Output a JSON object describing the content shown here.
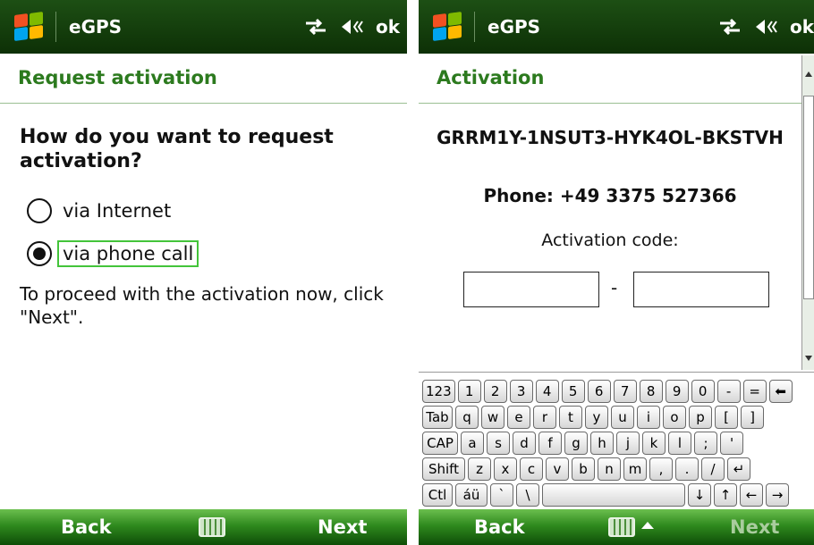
{
  "left_screen": {
    "title": "eGPS",
    "status_ok": "ok",
    "page_heading": "Request activation",
    "question": "How do you want to request activation?",
    "options": [
      {
        "label": "via Internet",
        "selected": false
      },
      {
        "label": "via phone call",
        "selected": true
      }
    ],
    "note": "To proceed with the activation now, click \"Next\".",
    "softkeys": {
      "left": "Back",
      "right": "Next"
    }
  },
  "right_screen": {
    "title": "eGPS",
    "status_ok": "ok",
    "page_heading": "Activation",
    "installation_code": "GRRM1Y-1NSUT3-HYK4OL-BKSTVH",
    "phone_line": "Phone: +49 3375 527366",
    "activation_code_label": "Activation code:",
    "activation_code_part1": "",
    "activation_code_part2": "",
    "separator": "-",
    "softkeys": {
      "left": "Back",
      "right": "Next"
    },
    "keyboard_rows": [
      [
        "123",
        "1",
        "2",
        "3",
        "4",
        "5",
        "6",
        "7",
        "8",
        "9",
        "0",
        "-",
        "=",
        "⬅"
      ],
      [
        "Tab",
        "q",
        "w",
        "e",
        "r",
        "t",
        "y",
        "u",
        "i",
        "o",
        "p",
        "[",
        "]"
      ],
      [
        "CAP",
        "a",
        "s",
        "d",
        "f",
        "g",
        "h",
        "j",
        "k",
        "l",
        ";",
        "'"
      ],
      [
        "Shift",
        "z",
        "x",
        "c",
        "v",
        "b",
        "n",
        "m",
        ",",
        ".",
        "/",
        "↵"
      ],
      [
        "Ctl",
        "áü",
        "`",
        "\\",
        " ",
        "↓",
        "↑",
        "←",
        "→"
      ]
    ]
  },
  "icons": [
    "windows-logo-icon",
    "connectivity-icon",
    "volume-mute-icon",
    "keyboard-icon",
    "caret-up-icon"
  ],
  "colors": {
    "title_bar": "#0d3006",
    "heading_green": "#2c7a1e",
    "softkey_green": "#2f8a1e",
    "focus_green": "#43c43a"
  }
}
